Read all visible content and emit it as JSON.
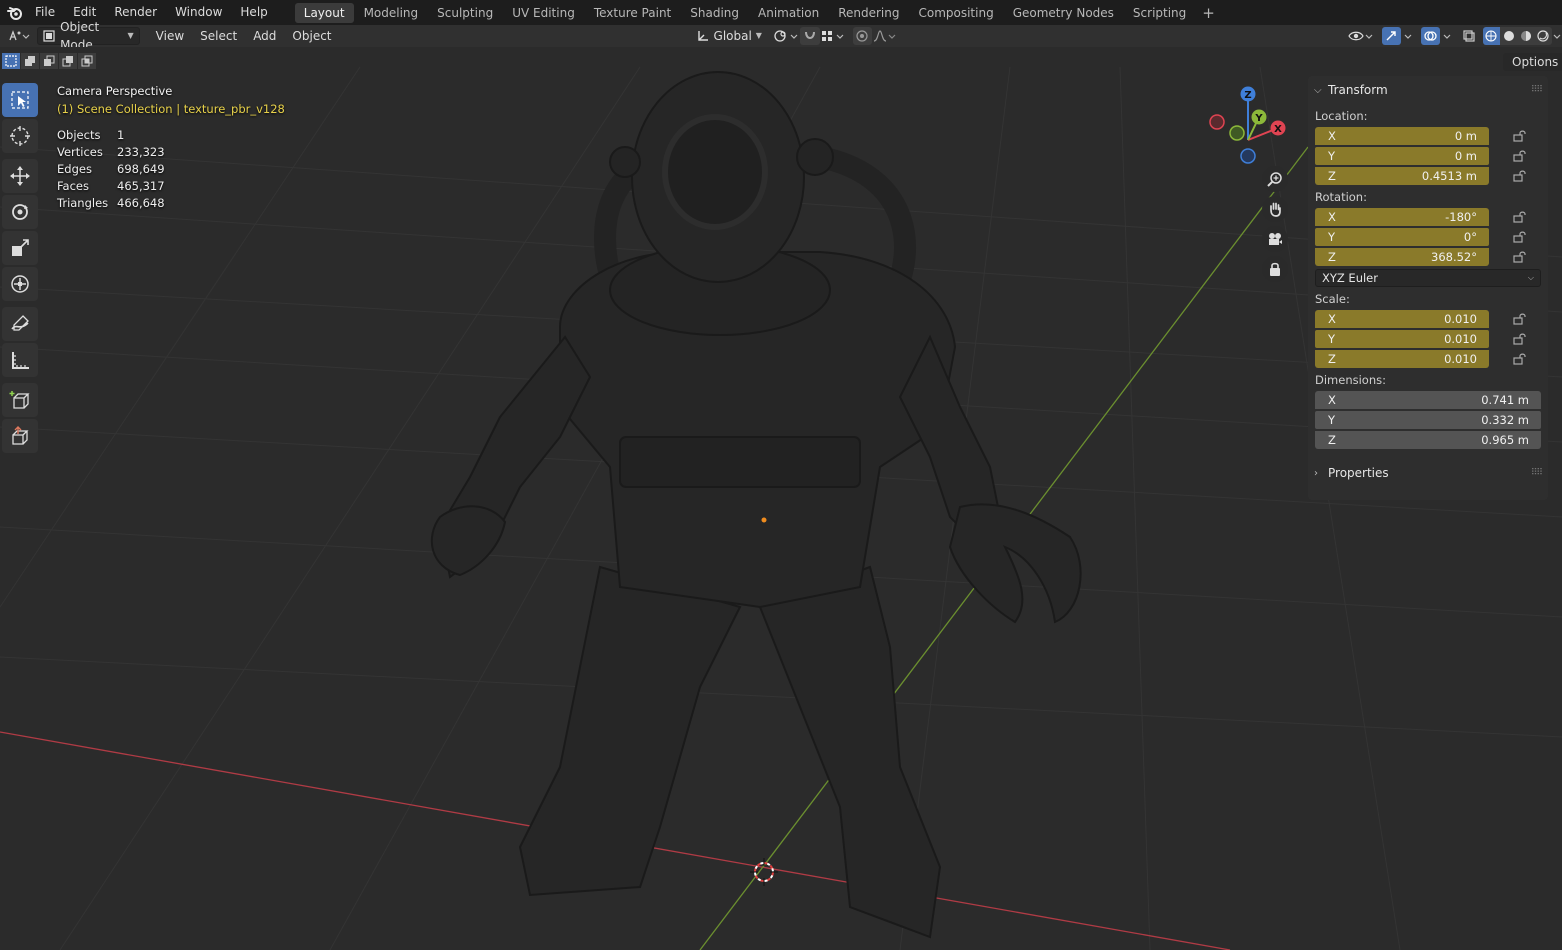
{
  "menubar": {
    "items": [
      "File",
      "Edit",
      "Render",
      "Window",
      "Help"
    ],
    "workspaces": [
      "Layout",
      "Modeling",
      "Sculpting",
      "UV Editing",
      "Texture Paint",
      "Shading",
      "Animation",
      "Rendering",
      "Compositing",
      "Geometry Nodes",
      "Scripting"
    ],
    "active_workspace": "Layout",
    "add_tab": "+"
  },
  "header": {
    "mode": "Object Mode",
    "menus": [
      "View",
      "Select",
      "Add",
      "Object"
    ],
    "transform_orientation": "Global"
  },
  "viewport": {
    "title": "Camera Perspective",
    "collection": "(1) Scene Collection | texture_pbr_v128",
    "stats": [
      {
        "label": "Objects",
        "value": "1"
      },
      {
        "label": "Vertices",
        "value": "233,323"
      },
      {
        "label": "Edges",
        "value": "698,649"
      },
      {
        "label": "Faces",
        "value": "465,317"
      },
      {
        "label": "Triangles",
        "value": "466,648"
      }
    ],
    "gizmo_axes": {
      "x": "X",
      "y": "Y",
      "z": "Z"
    },
    "options_label": "Options",
    "tools": [
      "select-box-tool",
      "cursor-tool",
      "move-tool",
      "rotate-tool",
      "scale-tool",
      "transform-tool",
      "annotate-tool",
      "measure-tool",
      "add-cube-tool",
      "extrude-tool"
    ]
  },
  "npanel": {
    "transform_header": "Transform",
    "location_label": "Location:",
    "location": [
      {
        "axis": "X",
        "value": "0 m"
      },
      {
        "axis": "Y",
        "value": "0 m"
      },
      {
        "axis": "Z",
        "value": "0.4513 m"
      }
    ],
    "rotation_label": "Rotation:",
    "rotation": [
      {
        "axis": "X",
        "value": "-180°"
      },
      {
        "axis": "Y",
        "value": "0°"
      },
      {
        "axis": "Z",
        "value": "368.52°"
      }
    ],
    "rotation_mode": "XYZ Euler",
    "scale_label": "Scale:",
    "scale": [
      {
        "axis": "X",
        "value": "0.010"
      },
      {
        "axis": "Y",
        "value": "0.010"
      },
      {
        "axis": "Z",
        "value": "0.010"
      }
    ],
    "dimensions_label": "Dimensions:",
    "dimensions": [
      {
        "axis": "X",
        "value": "0.741 m"
      },
      {
        "axis": "Y",
        "value": "0.332 m"
      },
      {
        "axis": "Z",
        "value": "0.965 m"
      }
    ],
    "properties_header": "Properties"
  },
  "colors": {
    "accent": "#4772b3",
    "animated_field": "#8a7a2a",
    "x_axis": "#e04452",
    "y_axis": "#8cb83a",
    "z_axis": "#3f7fd9",
    "collection_text": "#e7d14a"
  }
}
